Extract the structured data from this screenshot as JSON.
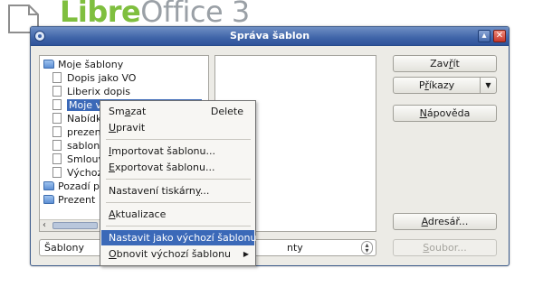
{
  "background": {
    "app_title_part1": "Libre",
    "app_title_part2": "Office",
    "app_title_part3": " 3"
  },
  "dialog": {
    "title": "Správa šablon",
    "icons": [
      "app-menu-icon",
      "maximize-icon",
      "close-icon"
    ]
  },
  "tree": {
    "folders": [
      {
        "label": "Moje šablony",
        "expanded": true
      },
      {
        "label": "Pozadí p"
      },
      {
        "label": "Prezent"
      }
    ],
    "items": [
      {
        "label": "Dopis jako VO"
      },
      {
        "label": "Liberix dopis"
      },
      {
        "label": "Moje výchozí šablona Calc",
        "selected": true
      },
      {
        "label": "Nabídk"
      },
      {
        "label": "prezen"
      },
      {
        "label": "sablon"
      },
      {
        "label": "Smlouv"
      },
      {
        "label": "Výchoz"
      }
    ]
  },
  "combos": {
    "left_value": "Šablony",
    "right_value": "nty"
  },
  "buttons": {
    "close_pre": "Zav",
    "close_u": "ř",
    "close_post": "ít",
    "commands_pre": "P",
    "commands_u": "ř",
    "commands_post": "íkazy",
    "help_pre": "",
    "help_u": "N",
    "help_post": "ápověda",
    "address_pre": "",
    "address_u": "A",
    "address_post": "dresář...",
    "file_pre": "",
    "file_u": "S",
    "file_post": "oubor..."
  },
  "context_menu": {
    "delete_pre": "Sm",
    "delete_u": "a",
    "delete_post": "zat",
    "delete_shortcut": "Delete",
    "edit_pre": "",
    "edit_u": "U",
    "edit_post": "pravit",
    "import_pre": "",
    "import_u": "I",
    "import_post": "mportovat šablonu...",
    "export_pre": "",
    "export_u": "E",
    "export_post": "xportovat šablonu...",
    "printer_pre": "Nastavení tiskárn",
    "printer_u": "y",
    "printer_post": "...",
    "update_pre": "",
    "update_u": "A",
    "update_post": "ktualizace",
    "set_default": "Nastavit jako výchozí šablonu",
    "reset_pre": "",
    "reset_u": "O",
    "reset_post": "bnovit výchozí šablonu"
  }
}
